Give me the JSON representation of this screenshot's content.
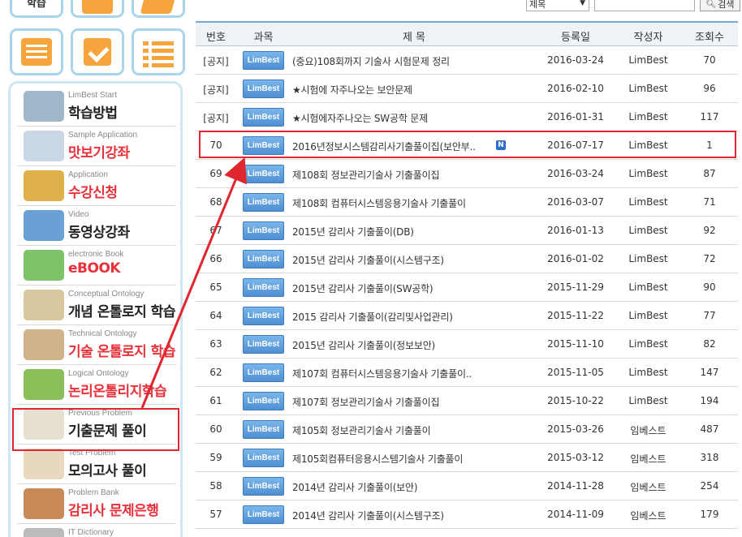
{
  "top_buttons": [
    {
      "label": "학습",
      "icon": "book-icon"
    },
    {
      "label": "",
      "icon": "calendar-icon"
    },
    {
      "label": "",
      "icon": "notebook-icon"
    }
  ],
  "quick_buttons": [
    {
      "icon": "list-card-icon"
    },
    {
      "icon": "checkbox-icon"
    },
    {
      "icon": "bullet-list-icon"
    }
  ],
  "sidebar": {
    "items": [
      {
        "en": "LimBest Start",
        "ko": "학습방법",
        "color": "dark"
      },
      {
        "en": "Sample Application",
        "ko": "맛보기강좌",
        "color": "red"
      },
      {
        "en": "Application",
        "ko": "수강신청",
        "color": "red"
      },
      {
        "en": "Video",
        "ko": "동영상강좌",
        "color": "dark"
      },
      {
        "en": "electronic Book",
        "ko": "eBOOK",
        "color": "red"
      },
      {
        "en": "Conceptual Ontology",
        "ko": "개념 온톨로지 학습",
        "color": "dark"
      },
      {
        "en": "Technical Ontology",
        "ko": "기술 온톨로지 학습",
        "color": "red"
      },
      {
        "en": "Logical Ontology",
        "ko": "논리온톨리지학습",
        "color": "red"
      },
      {
        "en": "Previous Problem",
        "ko": "기출문제 풀이",
        "color": "dark"
      },
      {
        "en": "Test Problem",
        "ko": "모의고사 풀이",
        "color": "dark"
      },
      {
        "en": "Problem Bank",
        "ko": "감리사 문제은행",
        "color": "red"
      },
      {
        "en": "IT Dictionary",
        "ko": "",
        "color": "dark"
      }
    ]
  },
  "search": {
    "select_value": "제목",
    "input_value": "",
    "button_label": "검색"
  },
  "table": {
    "headers": {
      "no": "번호",
      "subject": "과목",
      "title": "제 목",
      "date": "등록일",
      "author": "작성자",
      "views": "조회수"
    },
    "badge_label": "LimBest",
    "new_mark": "N",
    "rows": [
      {
        "no": "[공지]",
        "title": "(중요)108회까지 기술사 시험문제 정리",
        "date": "2016-03-24",
        "author": "LimBest",
        "views": "70"
      },
      {
        "no": "[공지]",
        "title": "★시험에 자주나오는 보안문제",
        "date": "2016-02-10",
        "author": "LimBest",
        "views": "96"
      },
      {
        "no": "[공지]",
        "title": "★시험에자주나오는 SW공학 문제",
        "date": "2016-01-31",
        "author": "LimBest",
        "views": "117"
      },
      {
        "no": "70",
        "title": "2016년정보시스템감리사기출풀이집(보안부..",
        "date": "2016-07-17",
        "author": "LimBest",
        "views": "1",
        "is_new": true
      },
      {
        "no": "69",
        "title": "제108회 정보관리기술사 기출풀이집",
        "date": "2016-03-24",
        "author": "LimBest",
        "views": "87"
      },
      {
        "no": "68",
        "title": "제108회 컴퓨터시스템응용기술사 기출풀이",
        "date": "2016-03-07",
        "author": "LimBest",
        "views": "71"
      },
      {
        "no": "67",
        "title": "2015년 감리사 기출풀이(DB)",
        "date": "2016-01-13",
        "author": "LimBest",
        "views": "92"
      },
      {
        "no": "66",
        "title": "2015년 감리사 기출풀이(시스템구조)",
        "date": "2016-01-02",
        "author": "LimBest",
        "views": "72"
      },
      {
        "no": "65",
        "title": "2015년 감리사 기출풀이(SW공학)",
        "date": "2015-11-29",
        "author": "LimBest",
        "views": "90"
      },
      {
        "no": "64",
        "title": "2015 감리사 기출풀이(감리및사업관리)",
        "date": "2015-11-22",
        "author": "LimBest",
        "views": "77"
      },
      {
        "no": "63",
        "title": "2015년 감리사 기출풀이(정보보안)",
        "date": "2015-11-10",
        "author": "LimBest",
        "views": "82"
      },
      {
        "no": "62",
        "title": "제107회 컴퓨터시스템응용기술사 기출풀이..",
        "date": "2015-11-05",
        "author": "LimBest",
        "views": "147"
      },
      {
        "no": "61",
        "title": "제107회 정보관리기술사 기출풀이집",
        "date": "2015-10-22",
        "author": "LimBest",
        "views": "194"
      },
      {
        "no": "60",
        "title": "제105회 정보관리기술사 기출풀이",
        "date": "2015-03-26",
        "author": "임베스트",
        "views": "487"
      },
      {
        "no": "59",
        "title": "제105회컴퓨터응용시스템기술사 기출풀이",
        "date": "2015-03-12",
        "author": "임베스트",
        "views": "318"
      },
      {
        "no": "58",
        "title": "2014년 감리사 기출풀이(보안)",
        "date": "2014-11-28",
        "author": "임베스트",
        "views": "254"
      },
      {
        "no": "57",
        "title": "2014년 감리사 기출풀이(시스템구조)",
        "date": "2014-11-09",
        "author": "임베스트",
        "views": "179"
      }
    ]
  },
  "colors": {
    "accent_orange": "#f5a53b",
    "badge_blue": "#4f8fd3",
    "highlight_red": "#e0262e",
    "menu_red": "#e8313a"
  }
}
